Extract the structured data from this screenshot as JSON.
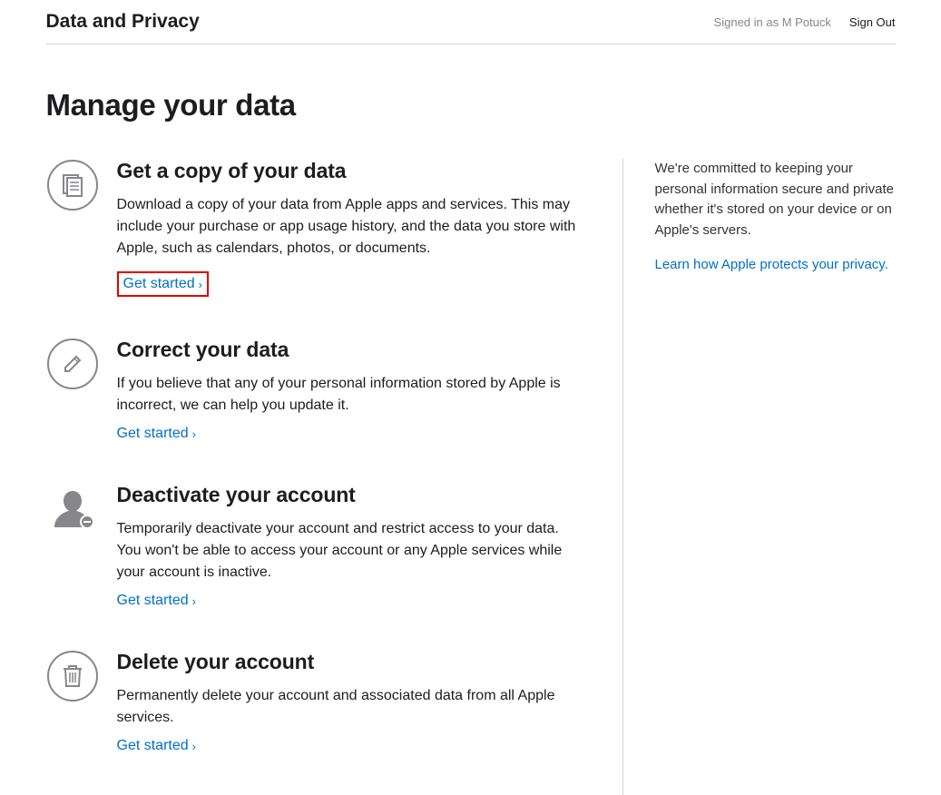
{
  "header": {
    "title": "Data and Privacy",
    "signed_in": "Signed in as M Potuck",
    "sign_out": "Sign Out"
  },
  "page_heading": "Manage your data",
  "sections": {
    "copy": {
      "title": "Get a copy of your data",
      "description": "Download a copy of your data from Apple apps and services. This may include your purchase or app usage history, and the data you store with Apple, such as calendars, photos, or documents.",
      "link": "Get started"
    },
    "correct": {
      "title": "Correct your data",
      "description": "If you believe that any of your personal information stored by Apple is incorrect, we can help you update it.",
      "link": "Get started"
    },
    "deactivate": {
      "title": "Deactivate your account",
      "description": "Temporarily deactivate your account and restrict access to your data. You won't be able to access your account or any Apple services while your account is inactive.",
      "link": "Get started"
    },
    "delete": {
      "title": "Delete your account",
      "description": "Permanently delete your account and associated data from all Apple services.",
      "link": "Get started"
    }
  },
  "sidebar": {
    "text": "We're committed to keeping your personal information secure and private whether it's stored on your device or on Apple's servers.",
    "link": "Learn how Apple protects your privacy."
  }
}
